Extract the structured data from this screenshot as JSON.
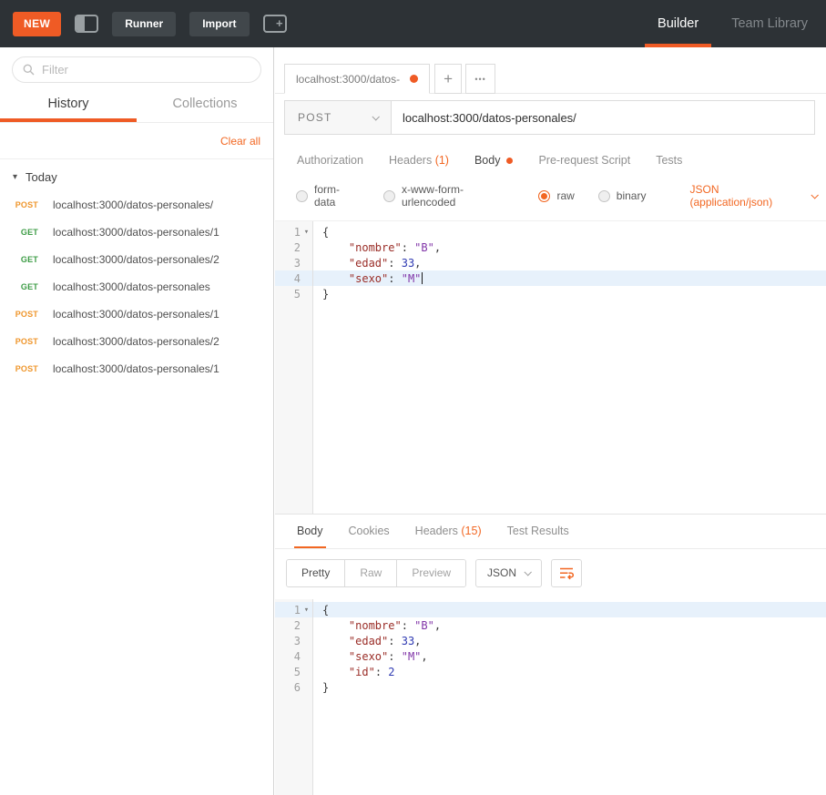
{
  "colors": {
    "accent_orange": "#ef5b25",
    "link_orange": "#f26722",
    "method_get_green": "#3d9c46",
    "method_post_orange": "#ef962c",
    "syntax_key": "#9a2d27",
    "syntax_string": "#8135a8",
    "syntax_number": "#2f3ab2",
    "active_line_blue": "#e7f1fb",
    "topbar_bg": "#2d3236"
  },
  "icons": {
    "plus_icon": "+",
    "more_icon": "•••",
    "collapse_arrow": "▾",
    "fold_arrow": "▾"
  },
  "topbar": {
    "new_label": "NEW",
    "runner_label": "Runner",
    "import_label": "Import",
    "builder_label": "Builder",
    "team_library_label": "Team Library"
  },
  "sidebar": {
    "filter_placeholder": "Filter",
    "tabs": [
      {
        "label": "History",
        "active": true
      },
      {
        "label": "Collections",
        "active": false
      }
    ],
    "clear_all_label": "Clear all",
    "section_label": "Today",
    "history": [
      {
        "method": "POST",
        "url": "localhost:3000/datos-personales/"
      },
      {
        "method": "GET",
        "url": "localhost:3000/datos-personales/1"
      },
      {
        "method": "GET",
        "url": "localhost:3000/datos-personales/2"
      },
      {
        "method": "GET",
        "url": "localhost:3000/datos-personales"
      },
      {
        "method": "POST",
        "url": "localhost:3000/datos-personales/1"
      },
      {
        "method": "POST",
        "url": "localhost:3000/datos-personales/2"
      },
      {
        "method": "POST",
        "url": "localhost:3000/datos-personales/1"
      }
    ]
  },
  "request": {
    "tab_title": "localhost:3000/datos-",
    "method": "POST",
    "url": "localhost:3000/datos-personales/",
    "tabs": [
      {
        "label": "Authorization"
      },
      {
        "label": "Headers",
        "count": "(1)"
      },
      {
        "label": "Body",
        "active": true,
        "dot": true
      },
      {
        "label": "Pre-request Script"
      },
      {
        "label": "Tests"
      }
    ],
    "body_types": [
      {
        "label": "form-data"
      },
      {
        "label": "x-www-form-urlencoded"
      },
      {
        "label": "raw",
        "selected": true
      },
      {
        "label": "binary"
      }
    ],
    "content_type": "JSON (application/json)",
    "editor_lines": [
      {
        "num": "1",
        "fold": true,
        "tokens": [
          [
            "pln",
            "{"
          ]
        ]
      },
      {
        "num": "2",
        "tokens": [
          [
            "pln",
            "    "
          ],
          [
            "key",
            "\"nombre\""
          ],
          [
            "pln",
            ": "
          ],
          [
            "str",
            "\"B\""
          ],
          [
            "pln",
            ","
          ]
        ]
      },
      {
        "num": "3",
        "tokens": [
          [
            "pln",
            "    "
          ],
          [
            "key",
            "\"edad\""
          ],
          [
            "pln",
            ": "
          ],
          [
            "num",
            "33"
          ],
          [
            "pln",
            ","
          ]
        ]
      },
      {
        "num": "4",
        "highlight": true,
        "cursor": true,
        "tokens": [
          [
            "pln",
            "    "
          ],
          [
            "key",
            "\"sexo\""
          ],
          [
            "pln",
            ": "
          ],
          [
            "str",
            "\"M\""
          ]
        ]
      },
      {
        "num": "5",
        "tokens": [
          [
            "pln",
            "}"
          ]
        ]
      }
    ]
  },
  "response": {
    "tabs": [
      {
        "label": "Body",
        "active": true
      },
      {
        "label": "Cookies"
      },
      {
        "label": "Headers",
        "count": "(15)"
      },
      {
        "label": "Test Results"
      }
    ],
    "view_modes": [
      {
        "label": "Pretty",
        "active": true
      },
      {
        "label": "Raw"
      },
      {
        "label": "Preview"
      }
    ],
    "format_label": "JSON",
    "editor_lines": [
      {
        "num": "1",
        "fold": true,
        "highlight": true,
        "tokens": [
          [
            "pln",
            "{"
          ]
        ]
      },
      {
        "num": "2",
        "tokens": [
          [
            "pln",
            "    "
          ],
          [
            "key",
            "\"nombre\""
          ],
          [
            "pln",
            ": "
          ],
          [
            "str",
            "\"B\""
          ],
          [
            "pln",
            ","
          ]
        ]
      },
      {
        "num": "3",
        "tokens": [
          [
            "pln",
            "    "
          ],
          [
            "key",
            "\"edad\""
          ],
          [
            "pln",
            ": "
          ],
          [
            "num",
            "33"
          ],
          [
            "pln",
            ","
          ]
        ]
      },
      {
        "num": "4",
        "tokens": [
          [
            "pln",
            "    "
          ],
          [
            "key",
            "\"sexo\""
          ],
          [
            "pln",
            ": "
          ],
          [
            "str",
            "\"M\""
          ],
          [
            "pln",
            ","
          ]
        ]
      },
      {
        "num": "5",
        "tokens": [
          [
            "pln",
            "    "
          ],
          [
            "key",
            "\"id\""
          ],
          [
            "pln",
            ": "
          ],
          [
            "num",
            "2"
          ]
        ]
      },
      {
        "num": "6",
        "tokens": [
          [
            "pln",
            "}"
          ]
        ]
      }
    ]
  }
}
